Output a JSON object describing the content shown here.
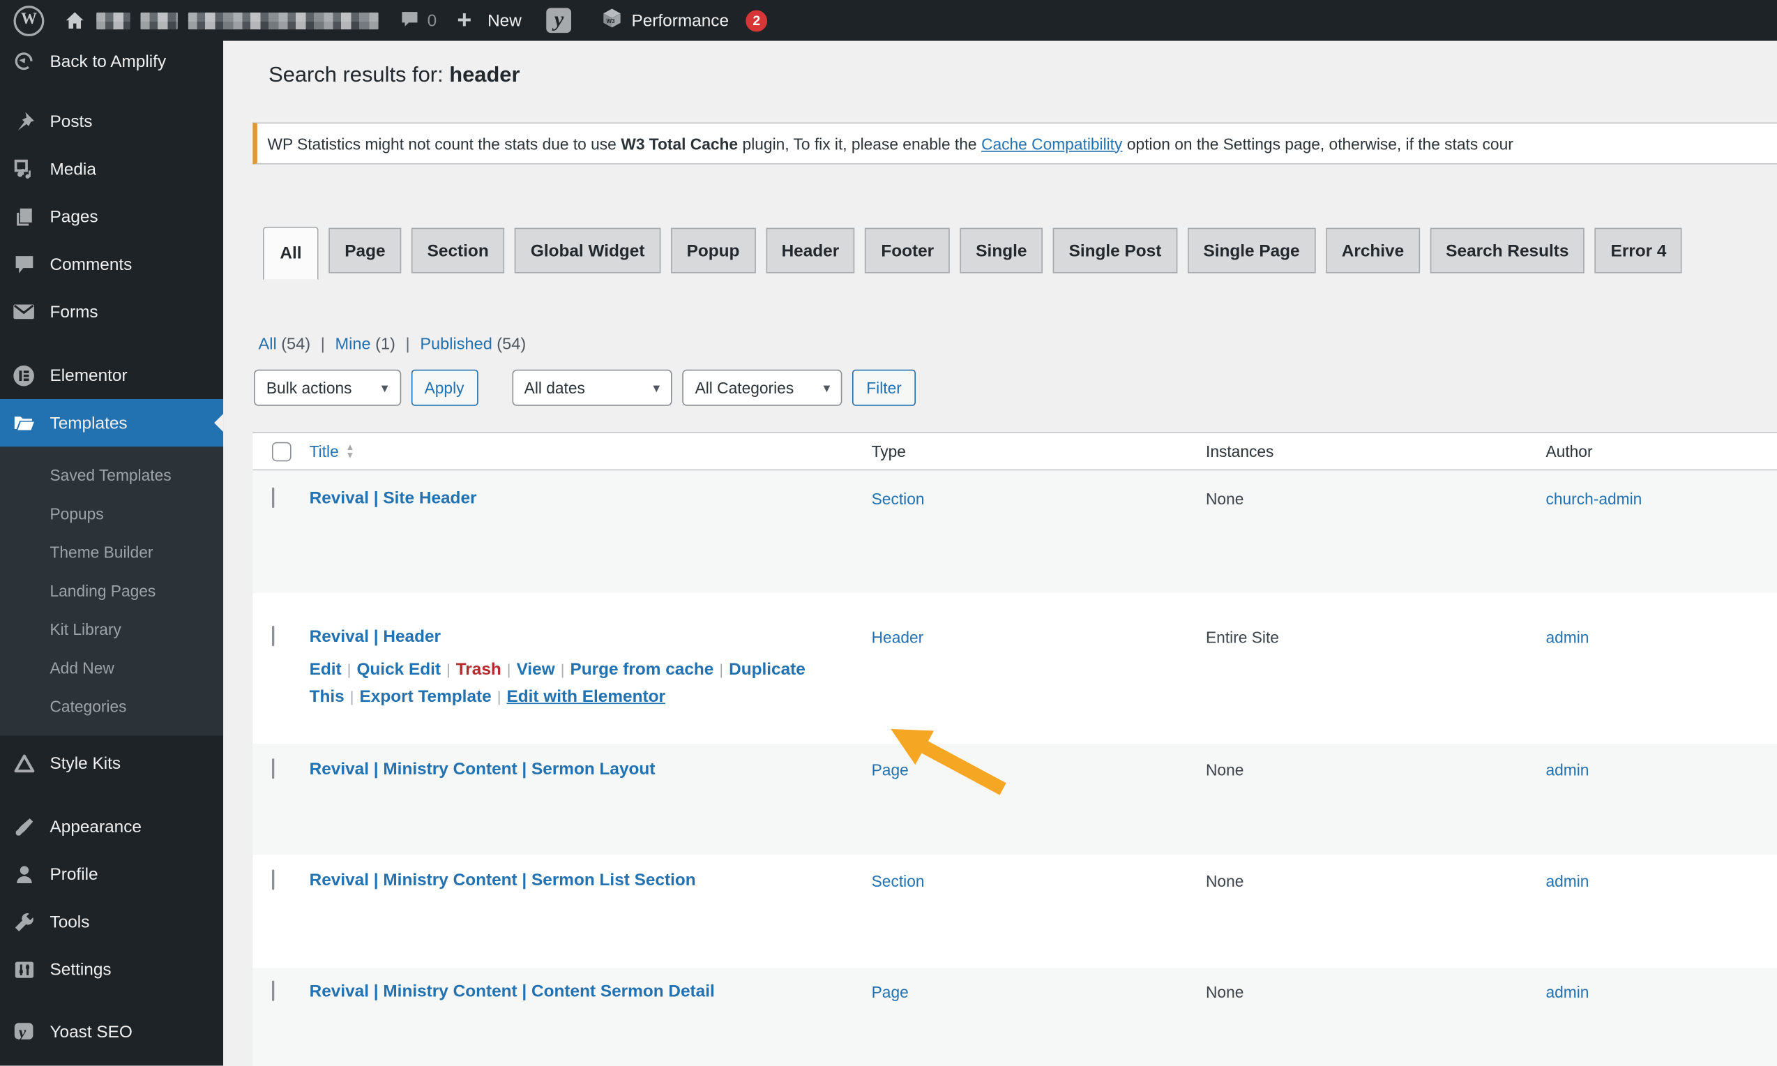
{
  "colors": {
    "accent": "#2271b1",
    "badge": "#d63638",
    "arrow": "#f5a623",
    "notice_border": "#dd9933",
    "trash": "#b32d2e"
  },
  "admin_bar": {
    "comments_count": "0",
    "new_label": "New",
    "performance_label": "Performance",
    "performance_badge": "2"
  },
  "sidebar": {
    "back_label": "Back to Amplify",
    "items": [
      {
        "label": "Posts"
      },
      {
        "label": "Media"
      },
      {
        "label": "Pages"
      },
      {
        "label": "Comments"
      },
      {
        "label": "Forms"
      },
      {
        "label": "Elementor"
      },
      {
        "label": "Templates"
      },
      {
        "label": "Style Kits"
      },
      {
        "label": "Appearance"
      },
      {
        "label": "Profile"
      },
      {
        "label": "Tools"
      },
      {
        "label": "Settings"
      },
      {
        "label": "Yoast SEO"
      }
    ],
    "active_item": "Templates",
    "templates_submenu": [
      {
        "label": "Saved Templates"
      },
      {
        "label": "Popups"
      },
      {
        "label": "Theme Builder"
      },
      {
        "label": "Landing Pages"
      },
      {
        "label": "Kit Library"
      },
      {
        "label": "Add New"
      },
      {
        "label": "Categories"
      }
    ]
  },
  "page": {
    "heading_prefix": "Search results for: ",
    "heading_query": "header",
    "notice": {
      "text_before": "WP Statistics might not count the stats due to use",
      "bold": "W3 Total Cache",
      "text_middle": "plugin, To fix it, please enable the",
      "link": "Cache Compatibility",
      "text_after": "option on the Settings page, otherwise, if the stats cour"
    },
    "tabs": [
      {
        "label": "All"
      },
      {
        "label": "Page"
      },
      {
        "label": "Section"
      },
      {
        "label": "Global Widget"
      },
      {
        "label": "Popup"
      },
      {
        "label": "Header"
      },
      {
        "label": "Footer"
      },
      {
        "label": "Single"
      },
      {
        "label": "Single Post"
      },
      {
        "label": "Single Page"
      },
      {
        "label": "Archive"
      },
      {
        "label": "Search Results"
      },
      {
        "label": "Error 4"
      }
    ],
    "active_tab": "All",
    "views": [
      {
        "label": "All",
        "count": "(54)"
      },
      {
        "label": "Mine",
        "count": "(1)"
      },
      {
        "label": "Published",
        "count": "(54)"
      }
    ],
    "views_separator": "|",
    "filters": {
      "bulk_actions": "Bulk actions",
      "apply": "Apply",
      "all_dates": "All dates",
      "all_categories": "All Categories",
      "filter": "Filter"
    },
    "table": {
      "columns": [
        "Title",
        "Type",
        "Instances",
        "Author"
      ],
      "rows": [
        {
          "title": "Revival | Site Header",
          "type": "Section",
          "instances": "None",
          "author": "church-admin"
        },
        {
          "title": "Revival | Header",
          "type": "Header",
          "instances": "Entire Site",
          "author": "admin",
          "actions": [
            "Edit",
            "Quick Edit",
            "Trash",
            "View",
            "Purge from cache",
            "Duplicate This",
            "Export Template",
            "Edit with Elementor"
          ],
          "actions_separator": "|"
        },
        {
          "title": "Revival | Ministry Content | Sermon Layout",
          "type": "Page",
          "instances": "None",
          "author": "admin"
        },
        {
          "title": "Revival | Ministry Content | Sermon List Section",
          "type": "Section",
          "instances": "None",
          "author": "admin"
        },
        {
          "title": "Revival | Ministry Content | Content Sermon Detail",
          "type": "Page",
          "instances": "None",
          "author": "admin"
        }
      ]
    },
    "annotation_arrow_color": "#f5a623"
  }
}
